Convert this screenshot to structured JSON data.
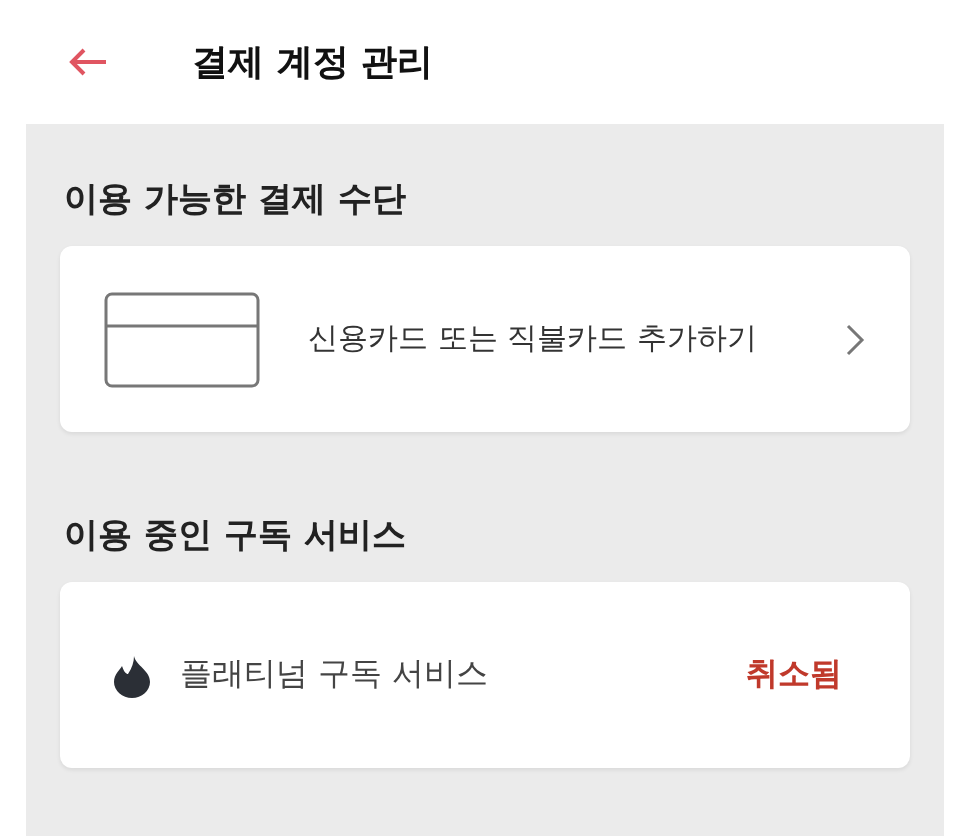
{
  "header": {
    "title": "결제 계정 관리"
  },
  "payment_section": {
    "title": "이용 가능한 결제 수단",
    "items": [
      {
        "label": "신용카드 또는 직불카드 추가하기"
      }
    ]
  },
  "subscription_section": {
    "title": "이용 중인 구독 서비스",
    "items": [
      {
        "name": "플래티넘 구독 서비스",
        "status": "취소됨"
      }
    ]
  }
}
